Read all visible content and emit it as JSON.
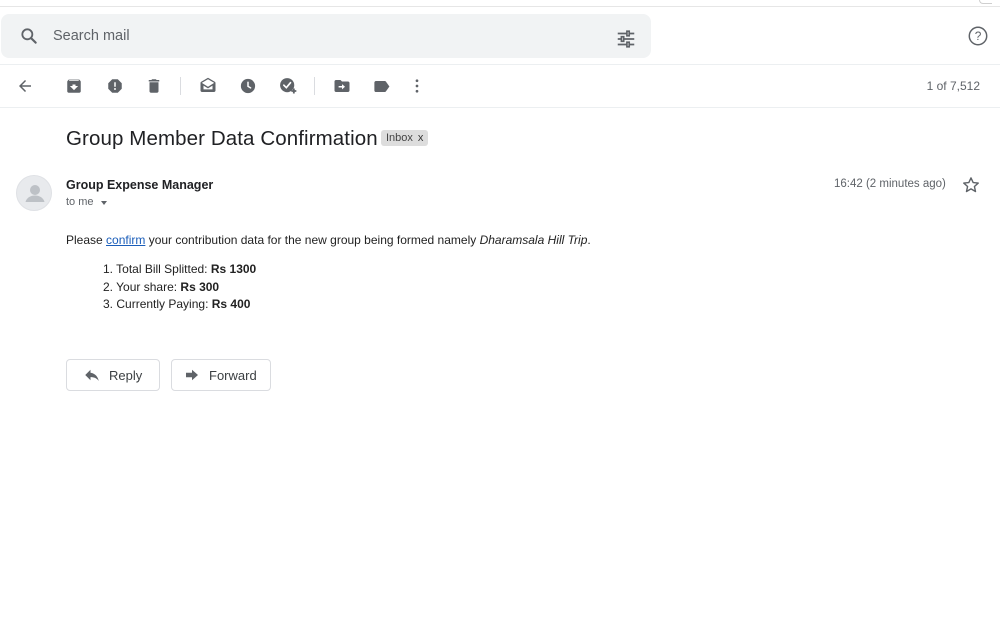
{
  "search": {
    "placeholder": "Search mail"
  },
  "icons": {
    "search": "search-icon",
    "tune": "tune-icon",
    "help": "help-icon",
    "back": "arrow-back-icon",
    "archive": "archive-icon",
    "spam": "report-spam-icon",
    "delete": "delete-icon",
    "mark_unread": "mark-unread-icon",
    "snooze": "snooze-icon",
    "add_task": "add-task-icon",
    "move_to": "move-to-icon",
    "labels": "label-icon",
    "more": "more-vert-icon",
    "star": "star-icon",
    "reply": "reply-icon",
    "forward": "forward-icon"
  },
  "toolbar": {
    "page_count": "1 of 7,512"
  },
  "message": {
    "subject": "Group Member Data Confirmation",
    "label": "Inbox",
    "label_remove": "x",
    "sender_name": "Group Expense Manager",
    "recipient": "to me",
    "timestamp": "16:42 (2 minutes ago)",
    "body": {
      "prefix": "Please ",
      "link_text": "confirm",
      "middle": " your contribution data for the new group being formed namely ",
      "group_name": "Dharamsala Hill Trip",
      "suffix": "."
    },
    "details": [
      {
        "number": "1.",
        "label": "Total Bill Splitted: ",
        "value": "Rs 1300"
      },
      {
        "number": "2.",
        "label": "Your share: ",
        "value": "Rs 300"
      },
      {
        "number": "3.",
        "label": "Currently Paying: ",
        "value": "Rs 400"
      }
    ]
  },
  "actions": {
    "reply_label": "Reply",
    "forward_label": "Forward"
  },
  "colors": {
    "link": "#1a5db9",
    "search_bg": "#f1f3f4",
    "icon_gray": "#5f6368",
    "chip_bg": "#dddddd"
  }
}
